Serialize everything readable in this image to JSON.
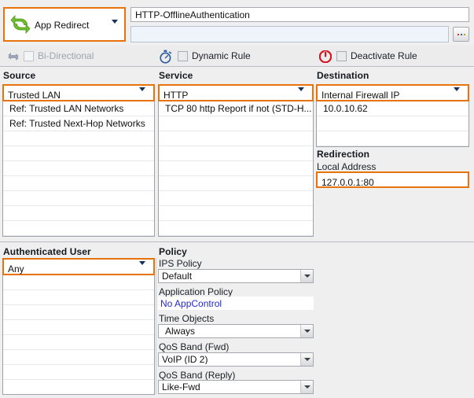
{
  "rule": {
    "action": {
      "label": "App Redirect",
      "icon": "two-green-arrows-redirect-icon"
    },
    "name_field": {
      "value": "HTTP-OfflineAuthentication",
      "placeholder": ""
    },
    "comment_field": {
      "value": "",
      "placeholder": ""
    },
    "browse_button": {
      "label": "...",
      "dots_colors": [
        "#c0392b",
        "#2a5caa",
        "#c89b2a"
      ]
    },
    "options": [
      {
        "label": "Bi-Directional",
        "icon": "bi-directional-arrows-icon",
        "checked": false,
        "enabled": false
      },
      {
        "label": "Dynamic Rule",
        "icon": "stopwatch-icon",
        "checked": false,
        "enabled": true
      },
      {
        "label": "Deactivate Rule",
        "icon": "power-off-icon",
        "checked": false,
        "enabled": true
      }
    ]
  },
  "source": {
    "title": "Source",
    "selected": "Trusted  LAN",
    "items": [
      "Ref: Trusted LAN Networks",
      "Ref: Trusted Next-Hop Networks"
    ],
    "empty_rows": 8
  },
  "service": {
    "title": "Service",
    "selected": "HTTP",
    "items": [
      "TCP  80 http  Report if not (STD-H..."
    ],
    "empty_rows": 9
  },
  "destination": {
    "title": "Destination",
    "selected": "Internal Firewall IP",
    "items": [
      "10.0.10.62"
    ],
    "empty_rows": 2
  },
  "redirection": {
    "title": "Redirection",
    "local_address_label": "Local Address",
    "local_address_value": "127.0.0.1:80"
  },
  "authenticated_user": {
    "title": "Authenticated User",
    "selected": "Any",
    "items": [],
    "empty_rows": 8
  },
  "policy": {
    "title": "Policy",
    "fields": [
      {
        "label": "IPS Policy",
        "value": "Default",
        "type": "combo"
      },
      {
        "label": "Application Policy",
        "value": "No AppControl",
        "type": "link"
      },
      {
        "label": "Time Objects",
        "value": "Always",
        "type": "combo"
      },
      {
        "label": "QoS Band (Fwd)",
        "value": "VoIP (ID 2)",
        "type": "combo"
      },
      {
        "label": "QoS Band (Reply)",
        "value": "Like-Fwd",
        "type": "combo"
      }
    ]
  },
  "colors": {
    "focus_orange": "#e8730c",
    "link_blue": "#2727cf",
    "panel_grey": "#efeff0",
    "power_red": "#d8121a",
    "arrow_green": "#66bb2a"
  }
}
